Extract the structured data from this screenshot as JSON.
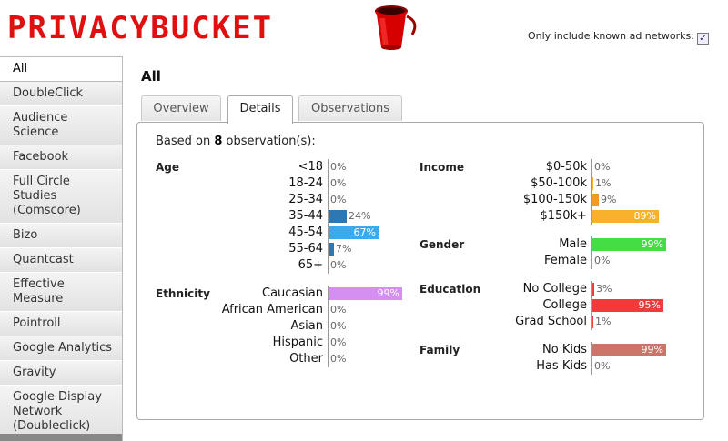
{
  "header": {
    "logo_text": "PRIVACYBUCKET",
    "option_label": "Only include known ad networks:",
    "option_checked": true
  },
  "sidebar": {
    "items": [
      {
        "label": "All",
        "active": true
      },
      {
        "label": "DoubleClick"
      },
      {
        "label": "Audience Science"
      },
      {
        "label": "Facebook"
      },
      {
        "label": "Full Circle Studies (Comscore)"
      },
      {
        "label": "Bizo"
      },
      {
        "label": "Quantcast"
      },
      {
        "label": "Effective Measure"
      },
      {
        "label": "Pointroll"
      },
      {
        "label": "Google Analytics"
      },
      {
        "label": "Gravity"
      },
      {
        "label": "Google Display Network (Doubleclick)"
      }
    ]
  },
  "main": {
    "title": "All",
    "tabs": [
      {
        "label": "Overview"
      },
      {
        "label": "Details",
        "active": true
      },
      {
        "label": "Observations"
      }
    ],
    "based_prefix": "Based on ",
    "based_count": "8",
    "based_suffix": " observation(s):"
  },
  "groups": [
    {
      "title": "Age",
      "color": "#2e77b0",
      "rows": [
        {
          "label": "<18",
          "value": 0,
          "text": "0%"
        },
        {
          "label": "18-24",
          "value": 0,
          "text": "0%"
        },
        {
          "label": "25-34",
          "value": 0,
          "text": "0%"
        },
        {
          "label": "35-44",
          "value": 24,
          "text": "24%"
        },
        {
          "label": "45-54",
          "value": 67,
          "text": "67%",
          "color": "#39aaee"
        },
        {
          "label": "55-64",
          "value": 7,
          "text": "7%"
        },
        {
          "label": "65+",
          "value": 0,
          "text": "0%"
        }
      ]
    },
    {
      "title": "Ethnicity",
      "color": "#d48ff0",
      "rows": [
        {
          "label": "Caucasian",
          "value": 99,
          "text": "99%"
        },
        {
          "label": "African American",
          "value": 0,
          "text": "0%"
        },
        {
          "label": "Asian",
          "value": 0,
          "text": "0%"
        },
        {
          "label": "Hispanic",
          "value": 0,
          "text": "0%"
        },
        {
          "label": "Other",
          "value": 0,
          "text": "0%"
        }
      ]
    },
    {
      "title": "Income",
      "color": "#f7b12a",
      "rows": [
        {
          "label": "$0-50k",
          "value": 0,
          "text": "0%"
        },
        {
          "label": "$50-100k",
          "value": 1,
          "text": "1%"
        },
        {
          "label": "$100-150k",
          "value": 9,
          "text": "9%",
          "color": "#f39a20"
        },
        {
          "label": "$150k+",
          "value": 89,
          "text": "89%"
        }
      ]
    },
    {
      "title": "Gender",
      "color": "#44dd44",
      "rows": [
        {
          "label": "Male",
          "value": 99,
          "text": "99%"
        },
        {
          "label": "Female",
          "value": 0,
          "text": "0%"
        }
      ]
    },
    {
      "title": "Education",
      "color": "#ee3b3b",
      "rows": [
        {
          "label": "No College",
          "value": 3,
          "text": "3%"
        },
        {
          "label": "College",
          "value": 95,
          "text": "95%"
        },
        {
          "label": "Grad School",
          "value": 1,
          "text": "1%"
        }
      ]
    },
    {
      "title": "Family",
      "color": "#c97567",
      "rows": [
        {
          "label": "No Kids",
          "value": 99,
          "text": "99%"
        },
        {
          "label": "Has Kids",
          "value": 0,
          "text": "0%"
        }
      ]
    }
  ]
}
